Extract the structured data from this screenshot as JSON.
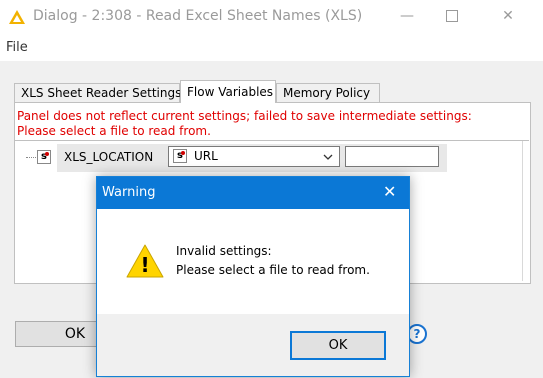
{
  "window": {
    "title": "Dialog - 2:308 - Read Excel Sheet Names (XLS)",
    "minimize_glyph": "—",
    "close_glyph": "✕"
  },
  "menu": {
    "file": "File"
  },
  "tabs": [
    {
      "label": "XLS Sheet Reader Settings",
      "active": false
    },
    {
      "label": "Flow Variables",
      "active": true
    },
    {
      "label": "Memory Policy",
      "active": false
    }
  ],
  "panel": {
    "error_line1": "Panel does not reflect current settings; failed to save intermediate settings:",
    "error_line2": "Please select a file to read from.",
    "variable": {
      "name": "XLS_LOCATION",
      "icon_letter": "s",
      "selected": "URL",
      "value": ""
    }
  },
  "buttons": {
    "ok": "OK",
    "help": "?"
  },
  "warning": {
    "title": "Warning",
    "close_glyph": "✕",
    "line1": "Invalid settings:",
    "line2": "Please select a file to read from.",
    "ok": "OK",
    "icon_mark": "!"
  },
  "colors": {
    "accent": "#0b78d6",
    "error_text": "#e00000",
    "warning_icon": "#ffd400"
  }
}
